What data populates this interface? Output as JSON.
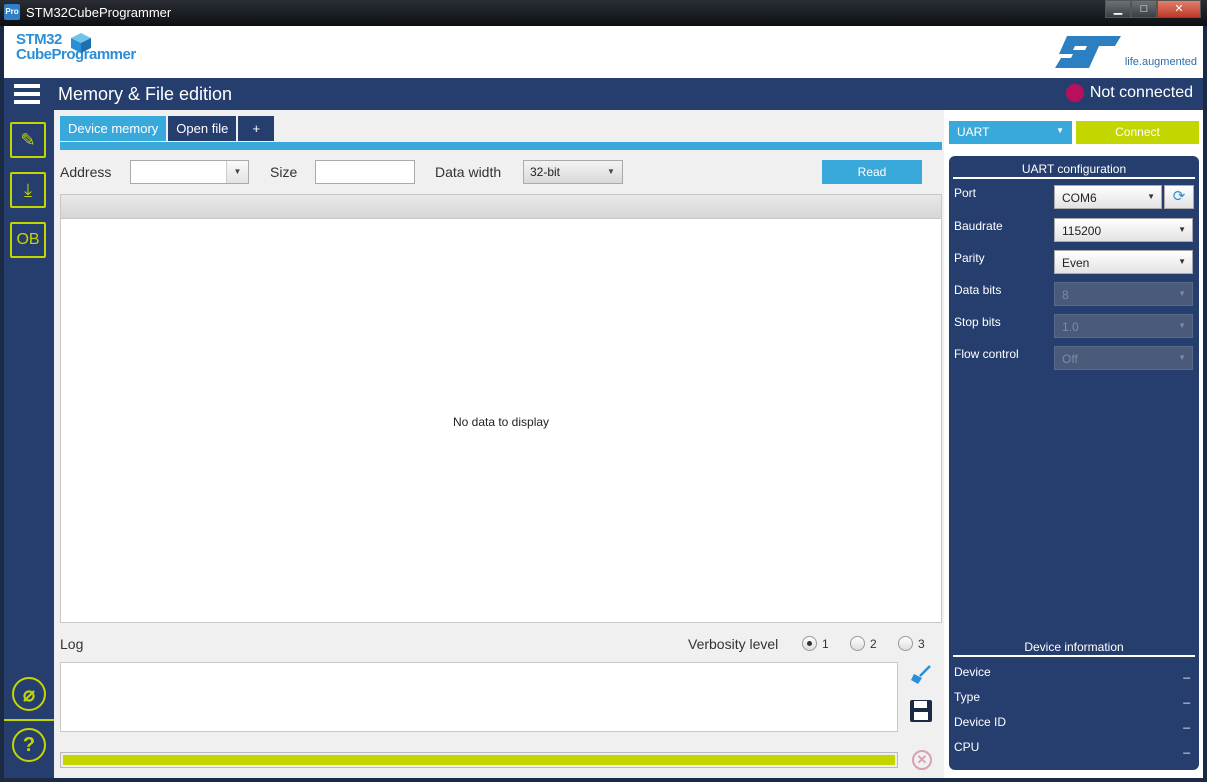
{
  "window": {
    "title": "STM32CubeProgrammer",
    "app_icon_label": "Pro",
    "minimize": "▁",
    "maximize": "□",
    "close": "✕"
  },
  "logo": {
    "line1": "STM32",
    "line2": "CubeProgrammer",
    "tagline": "life.augmented"
  },
  "navbar": {
    "title": "Memory & File edition",
    "status": "Not connected",
    "status_color": "#b7105f"
  },
  "sidebar": {
    "items": [
      {
        "icon": "edit-memory-icon",
        "glyph": "✎"
      },
      {
        "icon": "download-icon",
        "glyph": "⤓"
      },
      {
        "icon": "option-bytes-icon",
        "glyph": "OB"
      }
    ],
    "bottom": [
      {
        "icon": "erase-icon",
        "glyph": "⌀"
      },
      {
        "icon": "help-icon",
        "glyph": "?"
      }
    ]
  },
  "tabs": [
    {
      "label": "Device memory",
      "active": true
    },
    {
      "label": "Open file",
      "active": false
    },
    {
      "label": "+",
      "active": false
    }
  ],
  "toolbar": {
    "address_label": "Address",
    "address_value": "",
    "size_label": "Size",
    "size_value": "",
    "width_label": "Data width",
    "width_value": "32-bit",
    "read_label": "Read"
  },
  "data_panel": {
    "empty_text": "No data to display"
  },
  "log": {
    "title": "Log",
    "verbosity_label": "Verbosity level",
    "levels": [
      "1",
      "2",
      "3"
    ],
    "selected_level": "1",
    "progress": 1.0
  },
  "connection": {
    "interface": "UART",
    "connect_label": "Connect",
    "accent": "#c4d600",
    "primary": "#39a9dc"
  },
  "uart_config": {
    "title": "UART configuration",
    "rows": [
      {
        "label": "Port",
        "value": "COM6",
        "disabled": false
      },
      {
        "label": "Baudrate",
        "value": "115200",
        "disabled": false
      },
      {
        "label": "Parity",
        "value": "Even",
        "disabled": false
      },
      {
        "label": "Data bits",
        "value": "8",
        "disabled": true
      },
      {
        "label": "Stop bits",
        "value": "1.0",
        "disabled": true
      },
      {
        "label": "Flow control",
        "value": "Off",
        "disabled": true
      }
    ]
  },
  "device_info": {
    "title": "Device information",
    "rows": [
      {
        "label": "Device",
        "value": "_"
      },
      {
        "label": "Type",
        "value": "_"
      },
      {
        "label": "Device ID",
        "value": "_"
      },
      {
        "label": "CPU",
        "value": "_"
      }
    ]
  }
}
